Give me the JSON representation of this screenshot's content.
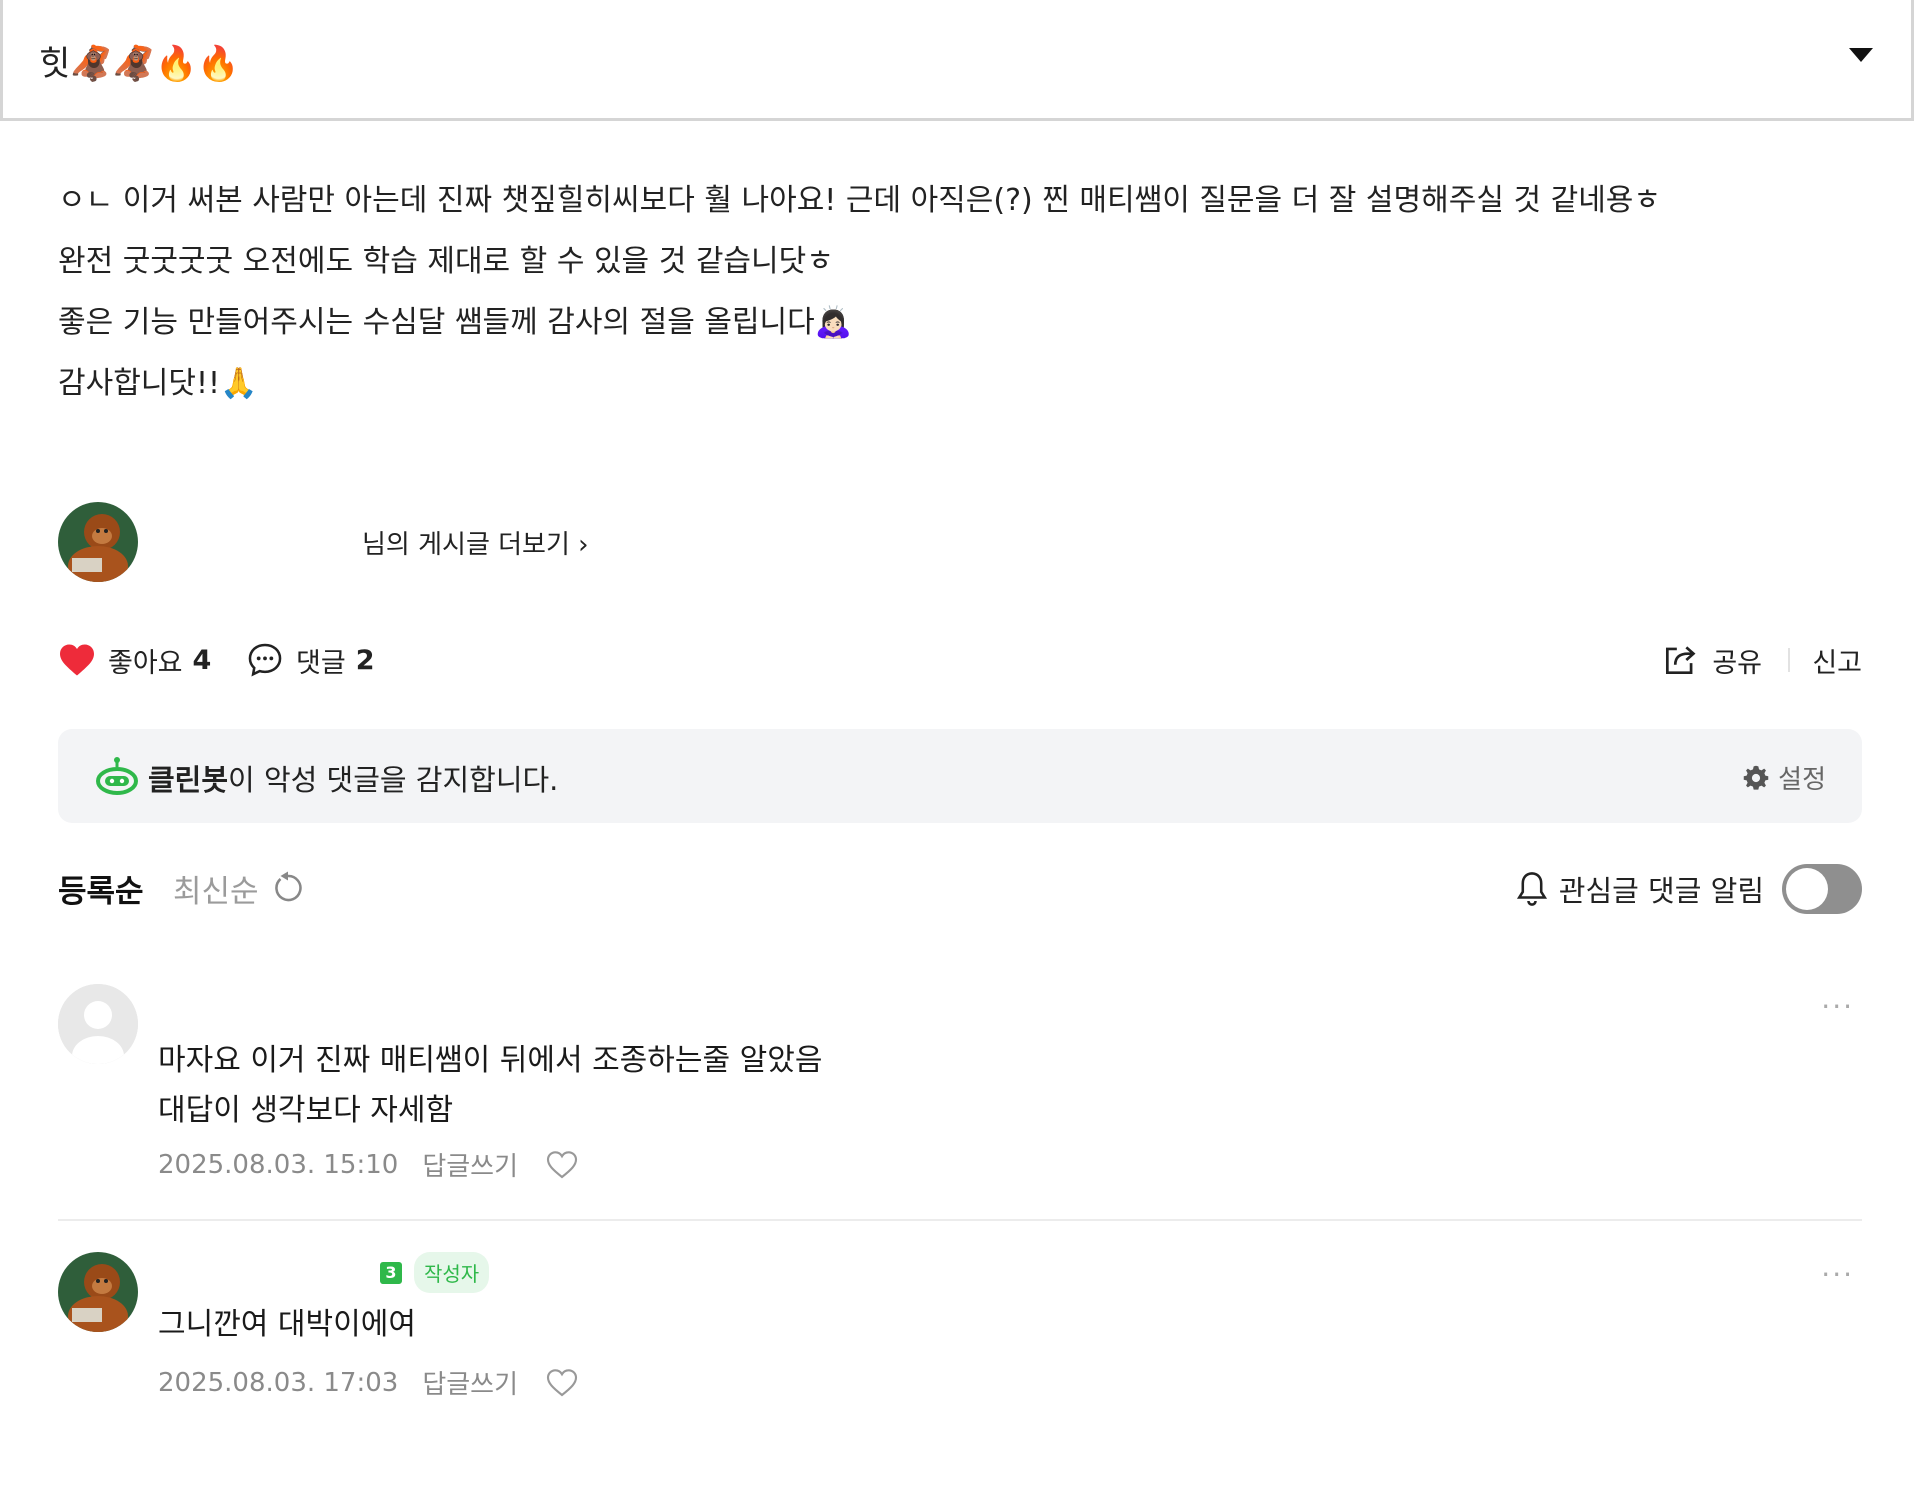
{
  "header": {
    "title": "힛🦧🦧🔥🔥"
  },
  "post": {
    "lines": [
      "ㅇㄴ 이거 써본 사람만 아는데 진짜 챗짚힐히씨보다 훨 나아요! 근데 아직은(?) 찐 매티쌤이 질문을 더 잘 설명해주실 것 같네용ㅎ",
      "완전 굿굿굿굿 오전에도 학습 제대로 할 수 있을 것 같습니닷ㅎ",
      "좋은 기능 만들어주시는 수심달 쌤들께 감사의 절을 올립니다🙇🏻‍♀️",
      "감사합니닷!!🙏"
    ]
  },
  "author": {
    "more_label": "님의 게시글 더보기"
  },
  "actions": {
    "like_label": "좋아요",
    "like_count": "4",
    "comment_label": "댓글",
    "comment_count": "2",
    "share_label": "공유",
    "report_label": "신고"
  },
  "cleanbot": {
    "name": "클린봇",
    "message": "이 악성 댓글을 감지합니다.",
    "settings_label": "설정"
  },
  "sort": {
    "registered_label": "등록순",
    "latest_label": "최신순",
    "alert_label": "관심글 댓글 알림",
    "alert_on": false
  },
  "comments": [
    {
      "lines": [
        "마자요 이거 진짜 매티쌤이 뒤에서 조종하는줄 알았음",
        "대답이 생각보다 자세함"
      ],
      "date": "2025.08.03. 15:10",
      "reply_label": "답글쓰기"
    },
    {
      "level": "3",
      "author_badge": "작성자",
      "lines": [
        "그니깐여 대박이에여"
      ],
      "date": "2025.08.03. 17:03",
      "reply_label": "답글쓰기"
    }
  ],
  "colors": {
    "heart": "#ee2b3a",
    "cleanbot_green": "#2fb84a",
    "toggle_off": "#8f8f8f"
  }
}
